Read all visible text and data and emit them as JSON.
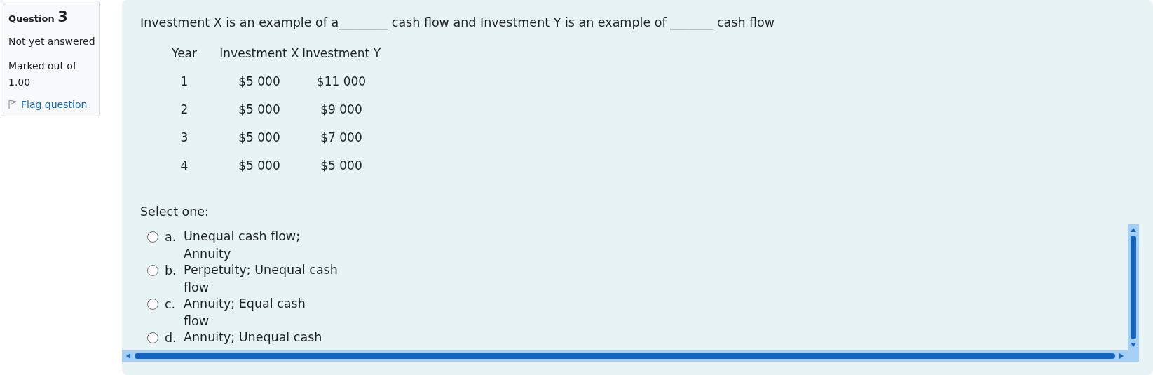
{
  "question_info": {
    "label": "Question",
    "number": "3",
    "status": "Not yet answered",
    "marks": "Marked out of 1.00",
    "flag": "Flag question"
  },
  "question": {
    "text": "Investment X is an example of a________ cash flow and Investment Y is an example of _______ cash flow",
    "table": {
      "columns": [
        "Year",
        "Investment X",
        "Investment Y"
      ],
      "rows": [
        [
          "1",
          "$5 000",
          "$11 000"
        ],
        [
          "2",
          "$5 000",
          "$9 000"
        ],
        [
          "3",
          "$5 000",
          "$7 000"
        ],
        [
          "4",
          "$5 000",
          "$5 000"
        ]
      ]
    },
    "prompt": "Select one:",
    "options": [
      {
        "letter": "a.",
        "lines": [
          "Unequal cash flow;",
          "Annuity"
        ],
        "selected": false
      },
      {
        "letter": "b.",
        "lines": [
          "Perpetuity; Unequal cash",
          "flow"
        ],
        "selected": false
      },
      {
        "letter": "c.",
        "lines": [
          "Annuity; Equal cash",
          "flow"
        ],
        "selected": false
      },
      {
        "letter": "d.",
        "lines": [
          "Annuity; Unequal cash"
        ],
        "selected": false
      }
    ]
  }
}
